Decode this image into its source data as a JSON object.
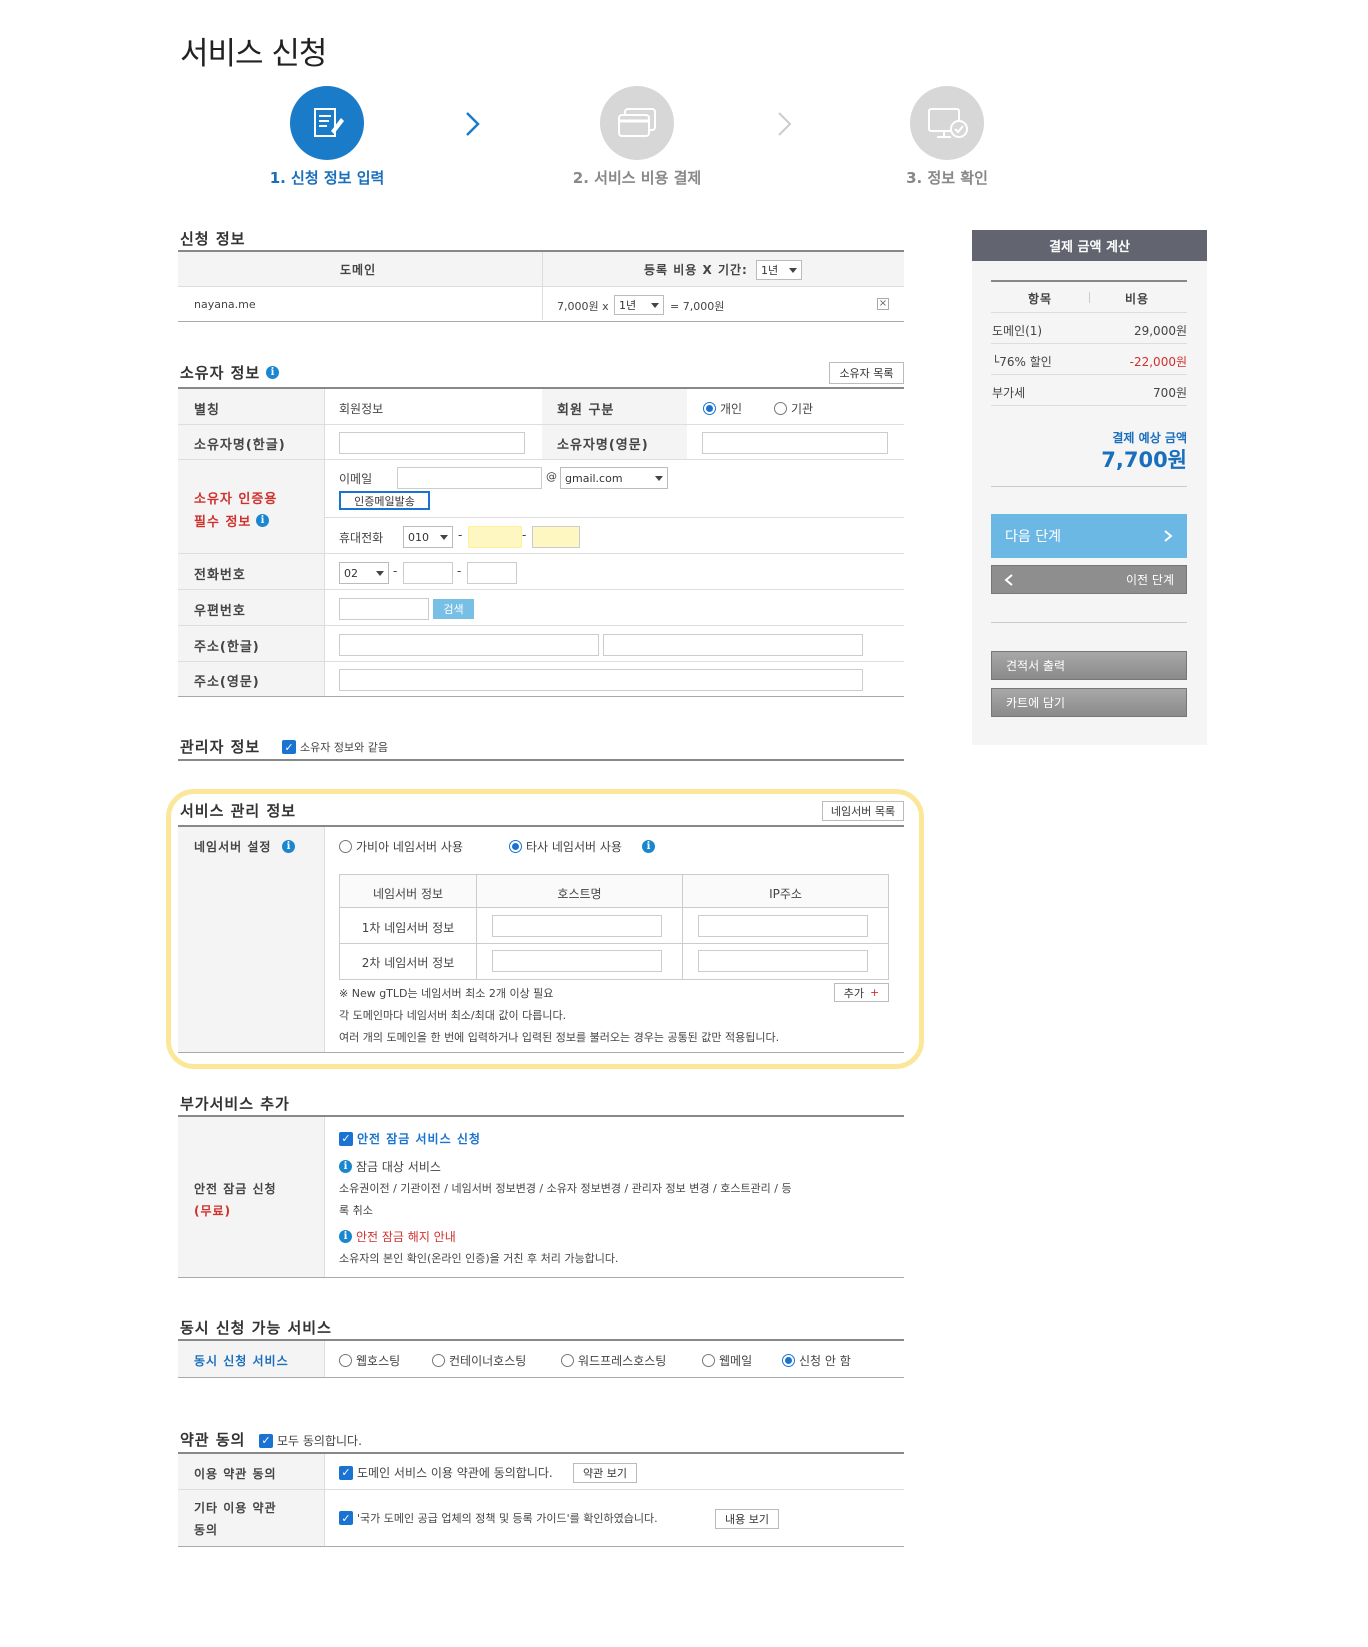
{
  "page": {
    "title": "서비스 신청"
  },
  "steps": [
    {
      "label": "1. 신청 정보 입력"
    },
    {
      "label": "2. 서비스 비용 결제"
    },
    {
      "label": "3. 정보 확인"
    }
  ],
  "application": {
    "title": "신청 정보",
    "col_domain": "도메인",
    "col_cost": "등록 비용 X 기간:",
    "period_header": "1년",
    "row": {
      "domain": "nayana.me",
      "price": "7,000원 x",
      "period": "1년",
      "total": "= 7,000원",
      "remove": "×"
    }
  },
  "owner": {
    "title": "소유자 정보",
    "list_button": "소유자 목록",
    "alias_label": "별칭",
    "alias_value": "회원정보",
    "member_type_label": "회원 구분",
    "member_type_options": [
      "개인",
      "기관"
    ],
    "name_ko_label": "소유자명(한글)",
    "name_en_label": "소유자명(영문)",
    "auth_label_1": "소유자 인증용",
    "auth_label_2": "필수 정보",
    "email_label": "이메일",
    "email_at": "@",
    "email_domain": "gmail.com",
    "send_auth_mail": "인증메일발송",
    "mobile_label": "휴대전화",
    "mobile_prefix": "010",
    "dash": "-",
    "phone_label": "전화번호",
    "phone_prefix": "02",
    "zip_label": "우편번호",
    "search_button": "검색",
    "addr_ko_label": "주소(한글)",
    "addr_en_label": "주소(영문)"
  },
  "admin": {
    "title": "관리자 정보",
    "same_as_owner": "소유자 정보와 같음"
  },
  "service": {
    "title": "서비스 관리 정보",
    "ns_list_button": "네임서버 목록",
    "ns_setting_label": "네임서버 설정",
    "ns_options": [
      "가비아 네임서버 사용",
      "타사 네임서버 사용"
    ],
    "ns_table_headers": [
      "네임서버 정보",
      "호스트명",
      "IP주소"
    ],
    "ns_rows": [
      "1차 네임서버 정보",
      "2차 네임서버 정보"
    ],
    "note1": "※ New gTLD는 네임서버 최소 2개 이상 필요",
    "add_button": "추가",
    "add_plus": "+",
    "note2": "각 도메인마다 네임서버 최소/최대 값이 다릅니다.",
    "note3": "여러 개의 도메인을 한 번에 입력하거나 입력된 정보를 불러오는 경우는 공통된 값만 적용됩니다."
  },
  "addon": {
    "title": "부가서비스 추가",
    "lock_label_1": "안전 잠금 신청",
    "lock_label_2": "(무료)",
    "lock_apply": "안전 잠금 서비스 신청",
    "lock_target_title": "잠금 대상 서비스",
    "lock_target_desc_1": "소유권이전 / 기관이전 / 네임서버 정보변경 / 소유자 정보변경 / 관리자 정보 변경 / 호스트관리 / 등",
    "lock_target_desc_2": "록 취소",
    "lock_release_title": "안전 잠금 해지 안내",
    "lock_release_desc": "소유자의 본인 확인(온라인 인증)을 거친 후 처리 가능합니다."
  },
  "concurrent": {
    "title": "동시 신청 가능 서비스",
    "label": "동시 신청 서비스",
    "options": [
      "웹호스팅",
      "컨테이너호스팅",
      "워드프레스호스팅",
      "웹메일",
      "신청 안 함"
    ]
  },
  "terms": {
    "title": "약관 동의",
    "agree_all": "모두 동의합니다.",
    "usage_label": "이용 약관 동의",
    "usage_text": "도메인 서비스 이용 약관에 동의합니다.",
    "usage_button": "약관 보기",
    "other_label_1": "기타 이용 약관",
    "other_label_2": "동의",
    "other_text": "'국가 도메인 공급 업체의 정책 및 등록 가이드'를 확인하였습니다.",
    "other_button": "내용 보기"
  },
  "summary": {
    "title": "결제 금액 계산",
    "col_item": "항목",
    "col_cost": "비용",
    "rows": [
      {
        "item": "도메인(1)",
        "cost": "29,000원"
      },
      {
        "item": "└76% 할인",
        "cost": "-22,000원"
      },
      {
        "item": "부가세",
        "cost": "700원"
      }
    ],
    "total_label": "결제 예상 금액",
    "total_value": "7,700원",
    "next_button": "다음 단계",
    "prev_button": "이전 단계",
    "quote_button": "견적서 출력",
    "cart_button": "카트에 담기"
  },
  "colors": {
    "accent": "#1a7cc9",
    "discount": "#d0312d",
    "highlight": "#fbe79a",
    "next_button": "#6bb8e5"
  }
}
